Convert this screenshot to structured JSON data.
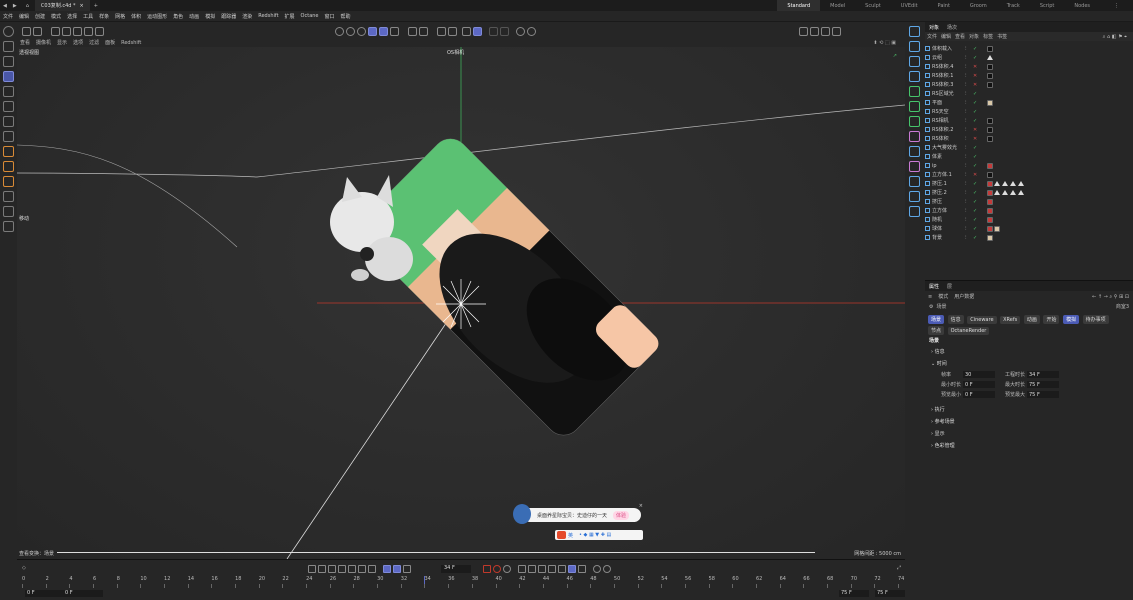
{
  "titlebar": {
    "file_tab": "C03复制.c4d *",
    "layouts": [
      "Standard",
      "Model",
      "Sculpt",
      "UVEdit",
      "Paint",
      "Groom",
      "Track",
      "Script",
      "Nodes"
    ]
  },
  "menubar": {
    "items": [
      "文件",
      "编辑",
      "创建",
      "模式",
      "选择",
      "工具",
      "样条",
      "网格",
      "体积",
      "运动图形",
      "角色",
      "动画",
      "模拟",
      "跟踪器",
      "渲染",
      "Redshift",
      "扩展",
      "Octane",
      "窗口",
      "帮助"
    ]
  },
  "viewport_menu": {
    "items": [
      "查看",
      "摄像机",
      "显示",
      "选项",
      "过滤",
      "面板",
      "Redshift"
    ]
  },
  "viewport": {
    "view_label": "透视视图",
    "camera_label": "OS相机",
    "mode_label": "移动",
    "bottom_left": "查看变换：场景",
    "bottom_right": "网格间距 : 5000 cm"
  },
  "object_manager": {
    "tabs": [
      "对象",
      "场次"
    ],
    "menu": [
      "文件",
      "编辑",
      "查看",
      "对象",
      "标签",
      "书签"
    ],
    "objects": [
      {
        "name": "体积载入",
        "check": "ok",
        "tags": [
          "dark"
        ]
      },
      {
        "name": "云组",
        "check": "ok",
        "tags": [
          "triangle"
        ]
      },
      {
        "name": "RS体积.4",
        "check": "x",
        "tags": [
          "dark"
        ]
      },
      {
        "name": "RS体积.1",
        "check": "x",
        "tags": [
          "dark"
        ]
      },
      {
        "name": "RS体积.3",
        "check": "x",
        "tags": [
          "dark"
        ]
      },
      {
        "name": "RS区域光",
        "check": "ok",
        "tags": []
      },
      {
        "name": "平面",
        "check": "ok",
        "tags": [
          "light"
        ]
      },
      {
        "name": "RS天空",
        "check": "ok",
        "tags": []
      },
      {
        "name": "RS相机",
        "check": "ok",
        "tags": [
          "dark"
        ]
      },
      {
        "name": "RS体积.2",
        "check": "x",
        "tags": [
          "dark"
        ]
      },
      {
        "name": "RS体积",
        "check": "x",
        "tags": [
          "dark"
        ]
      },
      {
        "name": "大气雾效光",
        "check": "ok",
        "tags": []
      },
      {
        "name": "体素",
        "check": "ok",
        "tags": []
      },
      {
        "name": "ip",
        "check": "ok",
        "tags": [
          "red"
        ]
      },
      {
        "name": "立方体.1",
        "check": "x",
        "tags": [
          "dark"
        ]
      },
      {
        "name": "挤压.1",
        "check": "ok",
        "tags": [
          "red",
          "triangles"
        ]
      },
      {
        "name": "挤压.2",
        "check": "ok",
        "tags": [
          "red",
          "triangles"
        ]
      },
      {
        "name": "挤压",
        "check": "ok",
        "tags": [
          "red"
        ]
      },
      {
        "name": "立方体",
        "check": "ok",
        "tags": [
          "red"
        ]
      },
      {
        "name": "随机",
        "check": "ok",
        "tags": [
          "red"
        ]
      },
      {
        "name": "球体",
        "check": "ok",
        "tags": [
          "red",
          "light"
        ]
      },
      {
        "name": "背景",
        "check": "ok",
        "tags": [
          "light"
        ]
      }
    ]
  },
  "attribute_manager": {
    "tabs": [
      "属性",
      "层"
    ],
    "menu": [
      "模式",
      "用户数据"
    ],
    "mode_label": "场景",
    "mode_right": "商室3",
    "pills_row1": [
      "场景",
      "信息",
      "Cineware",
      "XRefs",
      "动画",
      "开始",
      "模拟",
      "待办事项"
    ],
    "pills_row2": [
      "节点",
      "OctaneRender"
    ],
    "active_pill": "场景",
    "active_pill_2": "模拟",
    "title": "场景",
    "sections": [
      "信息",
      "时间",
      "执行",
      "参考场景",
      "显示",
      "色彩管理"
    ],
    "fields": [
      {
        "label": "帧率",
        "value": "30",
        "label2": "工程时长",
        "value2": "34 F"
      },
      {
        "label": "最小时长",
        "value": "0 F",
        "label2": "最大时长",
        "value2": "75 F"
      },
      {
        "label": "预览最小",
        "value": "0 F",
        "label2": "预览最大",
        "value2": "75 F"
      }
    ]
  },
  "timeline": {
    "current_frame": "34 F",
    "ticks": [
      "0",
      "2",
      "4",
      "6",
      "8",
      "10",
      "12",
      "14",
      "16",
      "18",
      "20",
      "22",
      "24",
      "26",
      "28",
      "30",
      "32",
      "34",
      "36",
      "38",
      "40",
      "42",
      "44",
      "46",
      "48",
      "50",
      "52",
      "54",
      "56",
      "58",
      "60",
      "62",
      "64",
      "66",
      "68",
      "70",
      "72",
      "74"
    ],
    "start_a": "0 F",
    "start_b": "0 F",
    "end_a": "75 F",
    "end_b": "75 F"
  },
  "popup": {
    "text": "桌面养星际宝贝：史迪仔的一天",
    "button": "体验"
  },
  "ime": {
    "lang": "英"
  },
  "colors": {
    "accent": "#5c68c4",
    "axis_red": "#c0392b",
    "axis_green": "#3fae5a",
    "ok_green": "#4cc36a",
    "x_red": "#d64a4a"
  }
}
